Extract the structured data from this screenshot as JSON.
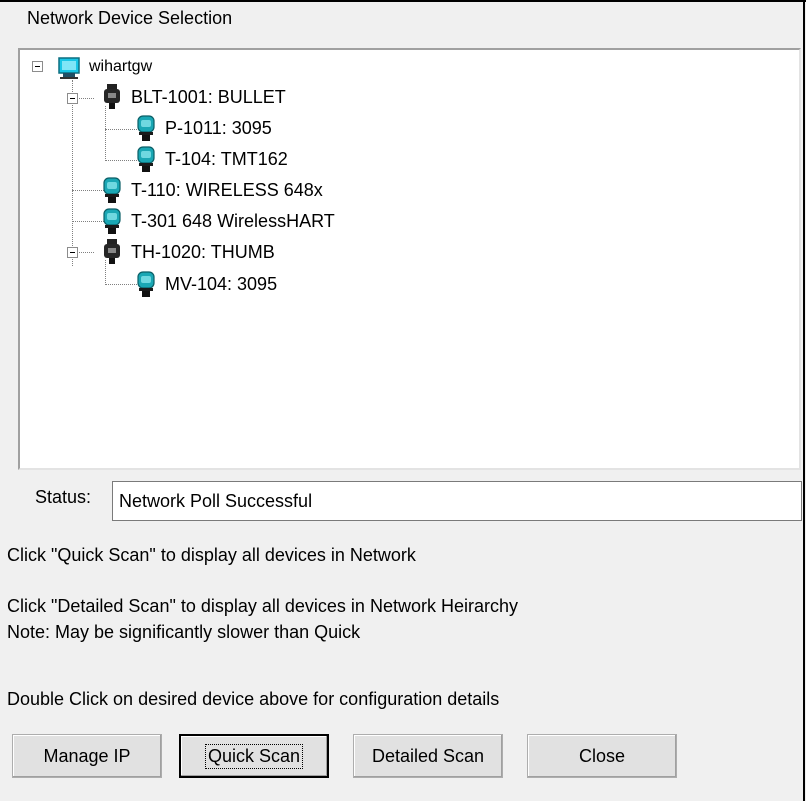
{
  "group_title": "Network Device Selection",
  "tree": {
    "root": "wihartgw",
    "nodes": [
      {
        "label": "BLT-1001: BULLET"
      },
      {
        "label": "P-1011: 3095"
      },
      {
        "label": "T-104: TMT162"
      },
      {
        "label": "T-110: WIRELESS 648x"
      },
      {
        "label": "T-301 648 WirelessHART"
      },
      {
        "label": "TH-1020: THUMB"
      },
      {
        "label": "MV-104: 3095"
      }
    ]
  },
  "status": {
    "label": "Status:",
    "value": "Network Poll Successful"
  },
  "notes": [
    "Click \"Quick Scan\" to display all devices in Network",
    "Click \"Detailed Scan\" to display all devices in Network Heirarchy",
    "Note: May be significantly slower than Quick",
    "Double Click on desired device above for configuration details"
  ],
  "buttons": {
    "manage_ip": "Manage IP",
    "quick_scan": "Quick Scan",
    "detailed_scan": "Detailed Scan",
    "close": "Close"
  },
  "colors": {
    "window_bg": "#f0f0f0",
    "field_bg": "#ffffff",
    "device_teal": "#1aa7b4",
    "gateway_cyan": "#18c6e6"
  }
}
